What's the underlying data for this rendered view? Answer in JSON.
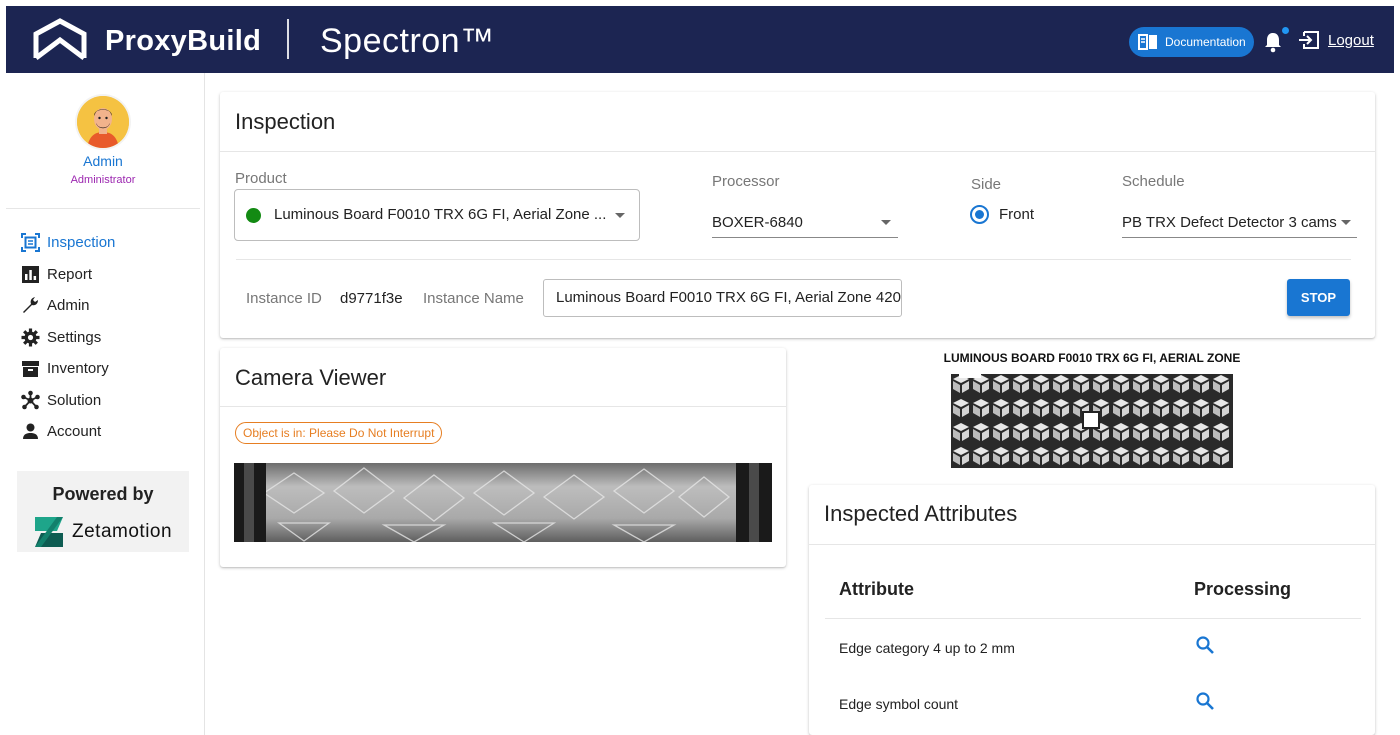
{
  "header": {
    "brand": "ProxyBuild",
    "product": "Spectron™",
    "documentation_label": "Documentation",
    "logout_label": "Logout",
    "colors": {
      "bar": "#1c2552",
      "accent": "#1976d2"
    }
  },
  "sidebar": {
    "user": {
      "name": "Admin",
      "role": "Administrator"
    },
    "items": [
      {
        "label": "Inspection",
        "icon": "inspection-icon",
        "active": true
      },
      {
        "label": "Report",
        "icon": "bar-chart-icon"
      },
      {
        "label": "Admin",
        "icon": "wrench-icon"
      },
      {
        "label": "Settings",
        "icon": "gear-icon"
      },
      {
        "label": "Inventory",
        "icon": "inventory-box-icon"
      },
      {
        "label": "Solution",
        "icon": "hub-icon"
      },
      {
        "label": "Account",
        "icon": "person-icon"
      }
    ],
    "powered_by": "Powered by",
    "partner": "Zetamotion"
  },
  "inspection": {
    "title": "Inspection",
    "product_label": "Product",
    "product_value": "Luminous Board F0010 TRX 6G FI, Aerial Zone ...",
    "product_status_color": "#138a13",
    "processor_label": "Processor",
    "processor_value": "BOXER-6840",
    "side_label": "Side",
    "side_value": "Front",
    "schedule_label": "Schedule",
    "schedule_value": "PB TRX Defect Detector 3 cams",
    "instance_id_label": "Instance ID",
    "instance_id_value": "d9771f3e",
    "instance_name_label": "Instance Name",
    "instance_name_value": "Luminous Board F0010 TRX 6G FI, Aerial Zone 420",
    "stop_label": "STOP"
  },
  "camera": {
    "title": "Camera Viewer",
    "status": "Object is in: Please Do Not Interrupt"
  },
  "board": {
    "title": "LUMINOUS BOARD F0010 TRX 6G FI, AERIAL ZONE"
  },
  "attributes": {
    "title": "Inspected Attributes",
    "columns": [
      "Attribute",
      "Processing"
    ],
    "rows": [
      {
        "attribute": "Edge category 4 up to 2 mm",
        "processing_icon": "search-icon"
      },
      {
        "attribute": "Edge symbol count",
        "processing_icon": "search-icon"
      }
    ]
  }
}
